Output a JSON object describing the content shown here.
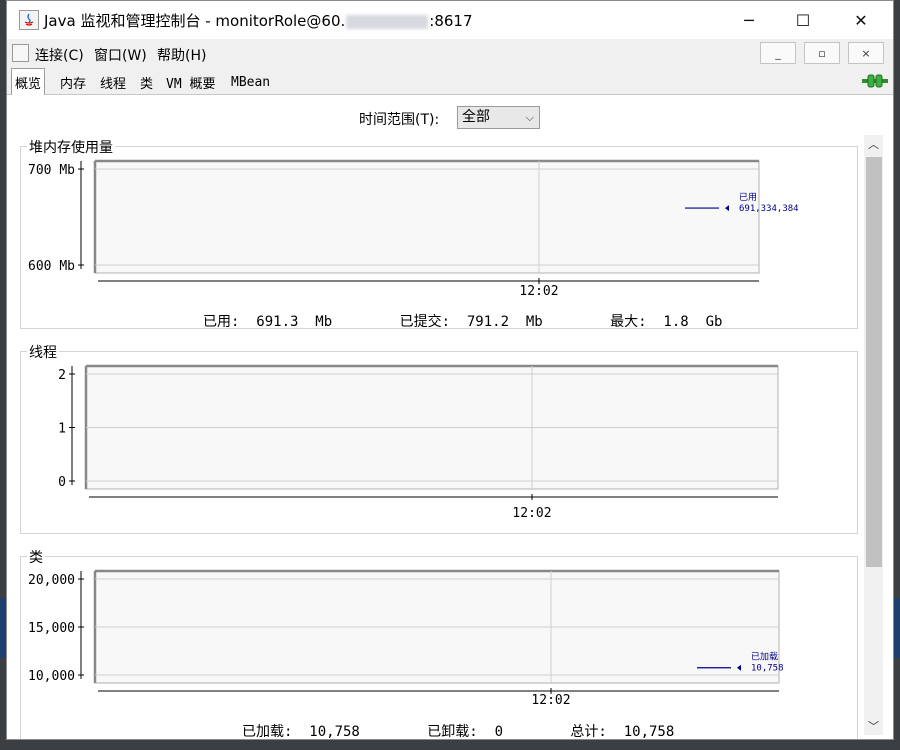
{
  "window": {
    "title_prefix": "Java 监视和管理控制台 - monitorRole@60.",
    "title_suffix": ":8617",
    "min_icon": "─",
    "max_icon": "☐",
    "close_icon": "✕"
  },
  "menu": {
    "items": [
      "连接(C)",
      "窗口(W)",
      "帮助(H)"
    ],
    "mdi": [
      "_",
      "▫",
      "×"
    ]
  },
  "tabs": [
    "概览",
    "内存",
    "线程",
    "类",
    "VM 概要",
    "MBean"
  ],
  "time_range": {
    "label": "时间范围(T):",
    "value": "全部"
  },
  "panels": {
    "heap": {
      "title": "堆内存使用量",
      "stats": "已用:  691.3  Mb        已提交:  791.2  Mb        最大:  1.8  Gb"
    },
    "threads": {
      "title": "线程"
    },
    "classes": {
      "title": "类",
      "stats": "已加载:  10,758        已卸载:  0        总计:  10,758"
    }
  },
  "chart_data": [
    {
      "type": "line",
      "title": "堆内存使用量",
      "y_ticks": [
        "700 Mb",
        "600 Mb"
      ],
      "x_ticks": [
        "12:02"
      ],
      "ylim": [
        600,
        700
      ],
      "series": [
        {
          "name": "已用",
          "values": [
            691334384
          ],
          "label": "691,334,384",
          "color": "#00008b"
        }
      ]
    },
    {
      "type": "line",
      "title": "线程",
      "y_ticks": [
        "2",
        "1",
        "0"
      ],
      "x_ticks": [
        "12:02"
      ],
      "ylim": [
        0,
        2
      ],
      "series": []
    },
    {
      "type": "line",
      "title": "类",
      "y_ticks": [
        "20,000",
        "15,000",
        "10,000"
      ],
      "x_ticks": [
        "12:02"
      ],
      "ylim": [
        10000,
        20000
      ],
      "series": [
        {
          "name": "已加载",
          "values": [
            10758
          ],
          "label": "10,758",
          "color": "#00008b"
        }
      ]
    }
  ]
}
